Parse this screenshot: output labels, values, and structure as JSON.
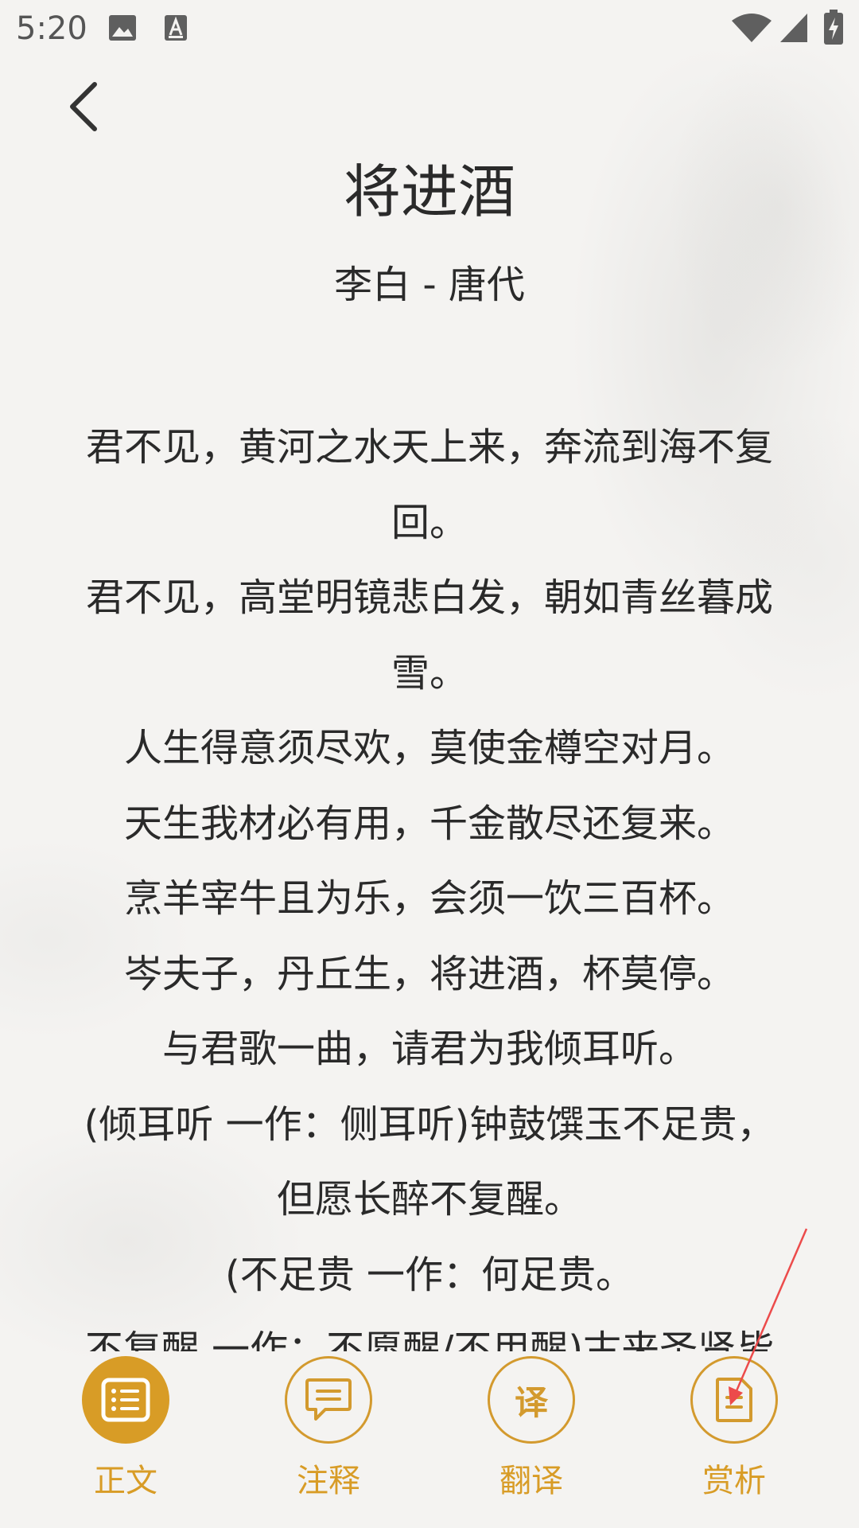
{
  "status_bar": {
    "time": "5:20",
    "icons": [
      "gallery-icon",
      "font-a-icon",
      "wifi-icon",
      "signal-icon",
      "battery-charging-icon"
    ]
  },
  "header": {
    "back_icon": "chevron-left-icon",
    "title": "将进酒",
    "author": "李白 - 唐代"
  },
  "poem": {
    "lines": [
      "君不见，黄河之水天上来，奔流到海不复",
      "回。",
      "君不见，高堂明镜悲白发，朝如青丝暮成",
      "雪。",
      "人生得意须尽欢，莫使金樽空对月。",
      "天生我材必有用，千金散尽还复来。",
      "烹羊宰牛且为乐，会须一饮三百杯。",
      "岑夫子，丹丘生，将进酒，杯莫停。",
      "与君歌一曲，请君为我倾耳听。",
      "(倾耳听 一作：侧耳听)钟鼓馔玉不足贵，",
      "但愿长醉不复醒。",
      "(不足贵 一作：何足贵。",
      "不复醒 一作：不愿醒/不用醒)古来圣贤皆"
    ]
  },
  "bottom_nav": {
    "items": [
      {
        "label": "正文",
        "icon": "list-doc-icon",
        "active": true
      },
      {
        "label": "注释",
        "icon": "comment-icon",
        "active": false
      },
      {
        "label": "翻译",
        "icon_text": "译",
        "icon": "translate-icon",
        "active": false
      },
      {
        "label": "赏析",
        "icon": "document-icon",
        "active": false
      }
    ]
  },
  "colors": {
    "accent": "#d89c26",
    "text": "#2a2a2a",
    "background": "#f4f3f1",
    "annotation": "#ec4b4b"
  }
}
